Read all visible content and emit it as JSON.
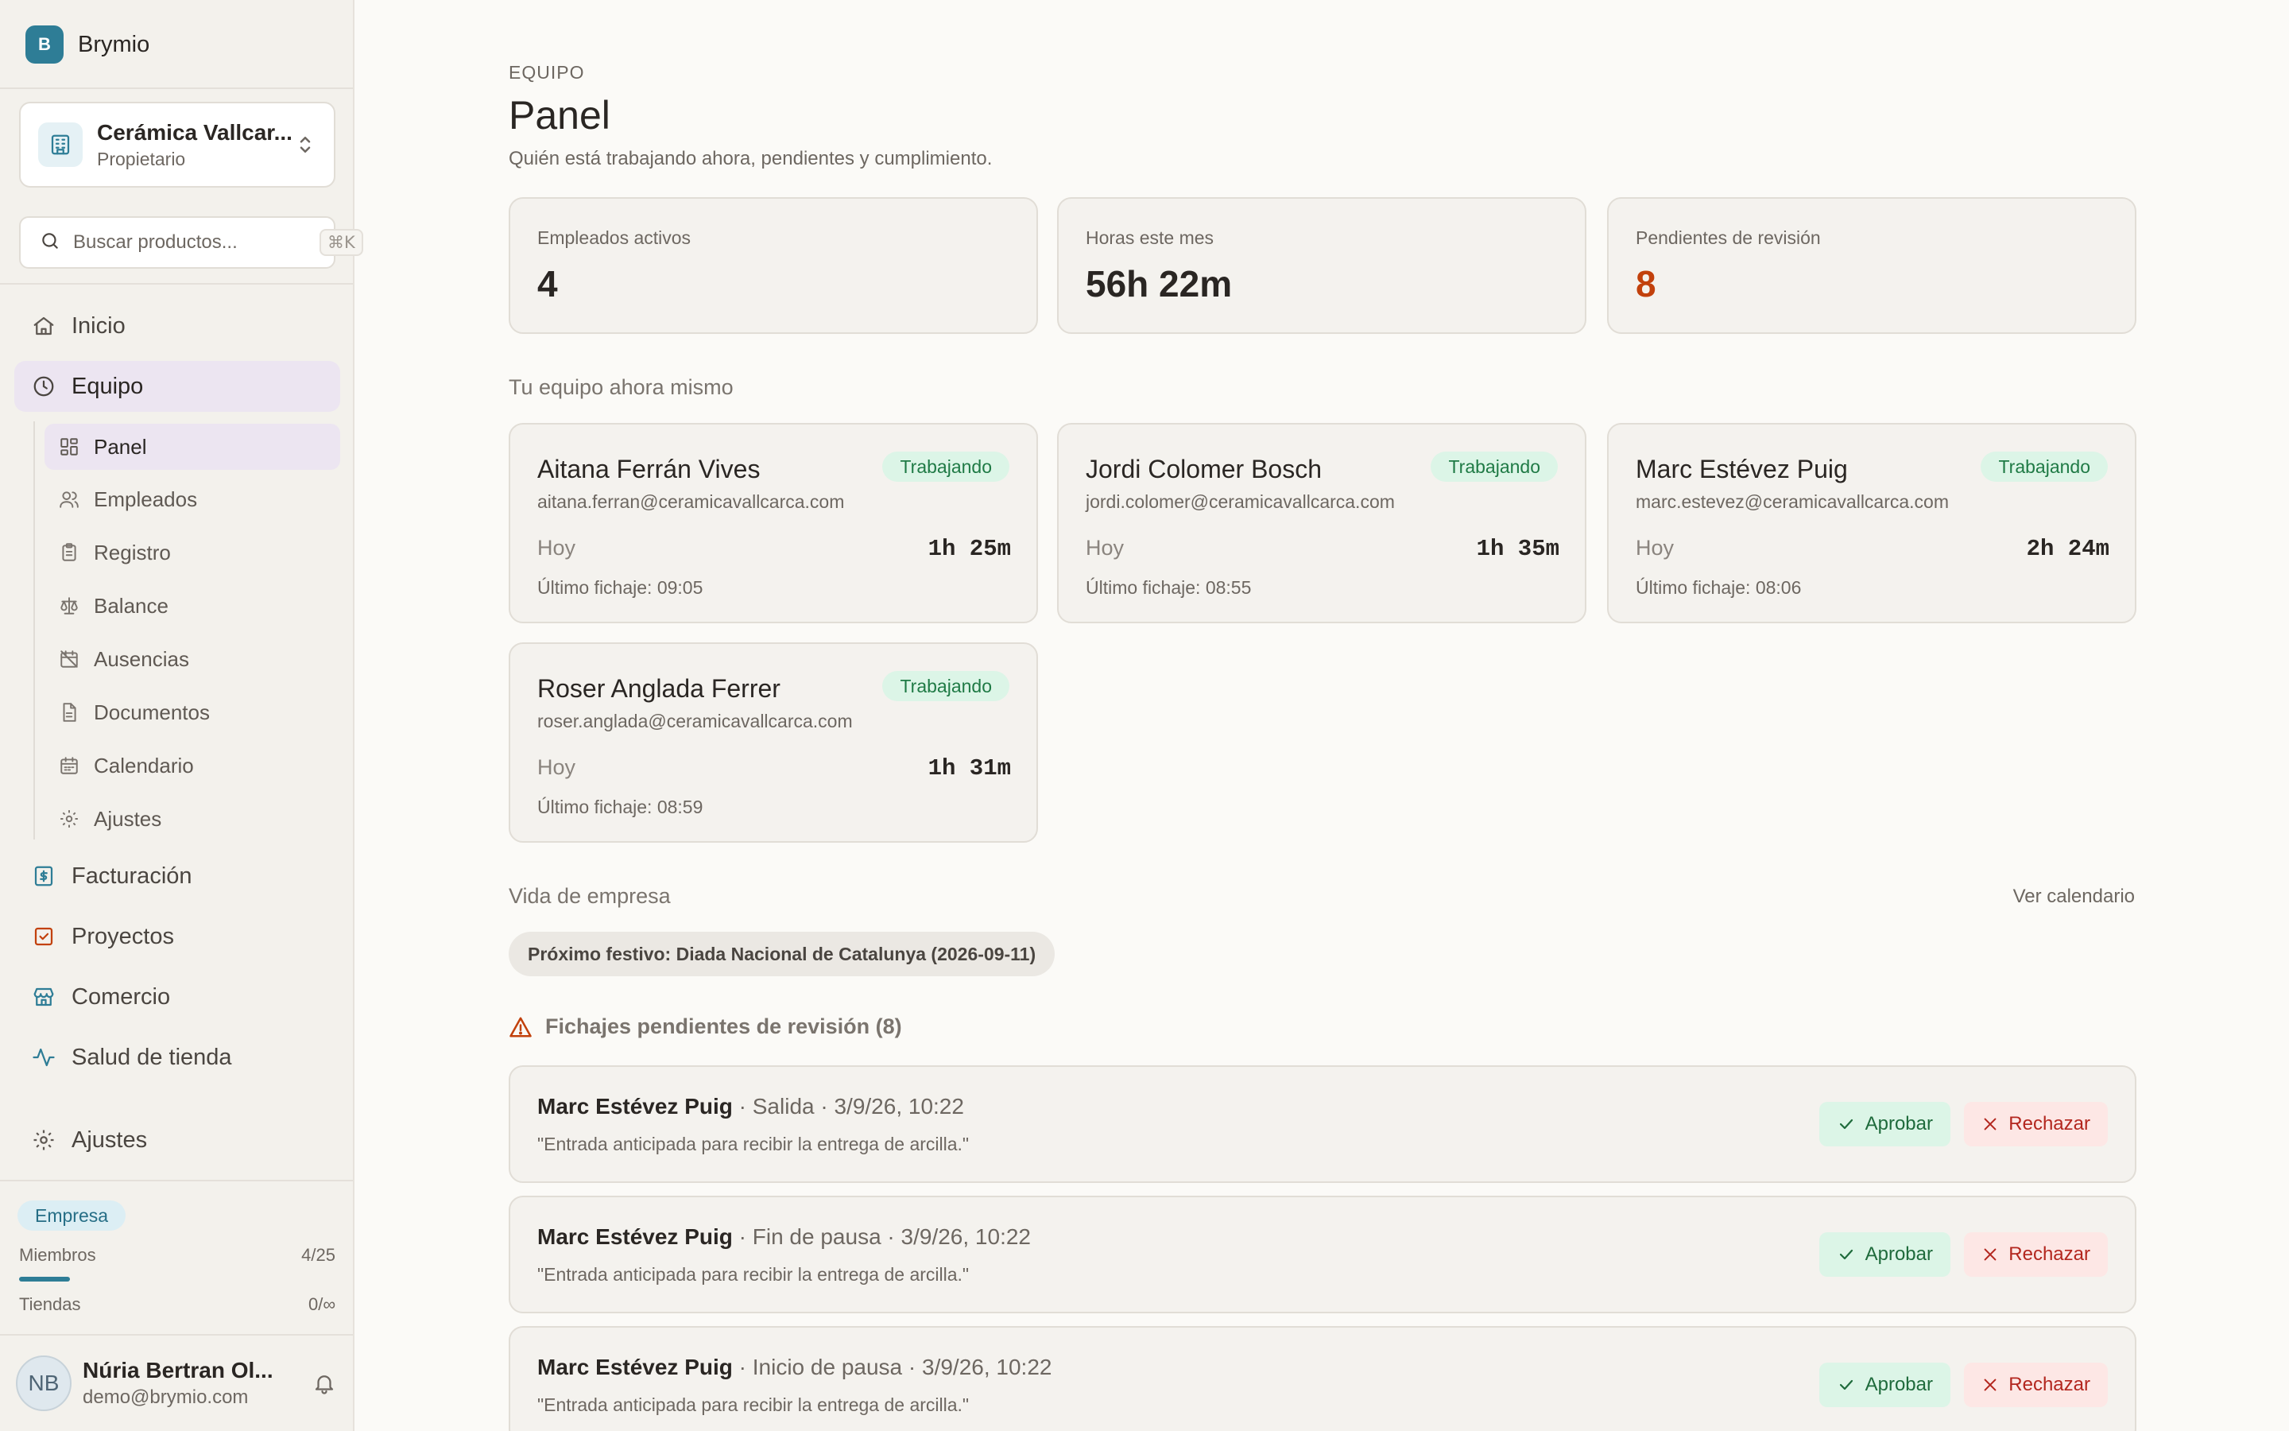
{
  "brand": {
    "logo_letter": "B",
    "name": "Brymio"
  },
  "org": {
    "name": "Cerámica Vallcar...",
    "role": "Propietario"
  },
  "search": {
    "placeholder": "Buscar productos...",
    "shortcut": "⌘K"
  },
  "nav": {
    "inicio": "Inicio",
    "equipo": "Equipo",
    "sub": {
      "panel": "Panel",
      "empleados": "Empleados",
      "registro": "Registro",
      "balance": "Balance",
      "ausencias": "Ausencias",
      "documentos": "Documentos",
      "calendario": "Calendario",
      "ajustes": "Ajustes"
    },
    "facturacion": "Facturación",
    "proyectos": "Proyectos",
    "comercio": "Comercio",
    "salud": "Salud de tienda",
    "ajustes": "Ajustes"
  },
  "plan": {
    "badge": "Empresa",
    "miembros_label": "Miembros",
    "miembros_value": "4/25",
    "miembros_fraction": 0.16,
    "tiendas_label": "Tiendas",
    "tiendas_value": "0/∞"
  },
  "user": {
    "initials": "NB",
    "name": "Núria Bertran Ol...",
    "email": "demo@brymio.com"
  },
  "page": {
    "eyebrow": "EQUIPO",
    "title": "Panel",
    "subtitle": "Quién está trabajando ahora, pendientes y cumplimiento."
  },
  "stats": {
    "empleados_label": "Empleados activos",
    "empleados_value": "4",
    "horas_label": "Horas este mes",
    "horas_value": "56h 22m",
    "pendientes_label": "Pendientes de revisión",
    "pendientes_value": "8"
  },
  "team": {
    "title": "Tu equipo ahora mismo",
    "members": [
      {
        "name": "Aitana Ferrán Vives",
        "email": "aitana.ferran@ceramicavallcarca.com",
        "status": "Trabajando",
        "today_label": "Hoy",
        "hours": "1h 25m",
        "last": "Último fichaje: 09:05"
      },
      {
        "name": "Jordi Colomer Bosch",
        "email": "jordi.colomer@ceramicavallcarca.com",
        "status": "Trabajando",
        "today_label": "Hoy",
        "hours": "1h 35m",
        "last": "Último fichaje: 08:55"
      },
      {
        "name": "Marc Estévez Puig",
        "email": "marc.estevez@ceramicavallcarca.com",
        "status": "Trabajando",
        "today_label": "Hoy",
        "hours": "2h 24m",
        "last": "Último fichaje: 08:06"
      },
      {
        "name": "Roser Anglada Ferrer",
        "email": "roser.anglada@ceramicavallcarca.com",
        "status": "Trabajando",
        "today_label": "Hoy",
        "hours": "1h 31m",
        "last": "Último fichaje: 08:59"
      }
    ]
  },
  "company": {
    "title": "Vida de empresa",
    "link": "Ver calendario",
    "holiday": "Próximo festivo: Diada Nacional de Catalunya (2026-09-11)"
  },
  "pending": {
    "title": "Fichajes pendientes de revisión (8)",
    "approve_label": "Aprobar",
    "reject_label": "Rechazar",
    "items": [
      {
        "name": "Marc Estévez Puig",
        "detail": " · Salida · 3/9/26, 10:22",
        "note": "\"Entrada anticipada para recibir la entrega de arcilla.\""
      },
      {
        "name": "Marc Estévez Puig",
        "detail": " · Fin de pausa · 3/9/26, 10:22",
        "note": "\"Entrada anticipada para recibir la entrega de arcilla.\""
      },
      {
        "name": "Marc Estévez Puig",
        "detail": " · Inicio de pausa · 3/9/26, 10:22",
        "note": "\"Entrada anticipada para recibir la entrega de arcilla.\""
      }
    ]
  },
  "colors": {
    "accent": "#2e7d96",
    "active_nav": "#ece5f1",
    "status_green": "#1f7a45",
    "warning": "#c2410c",
    "reject": "#b3261e"
  }
}
